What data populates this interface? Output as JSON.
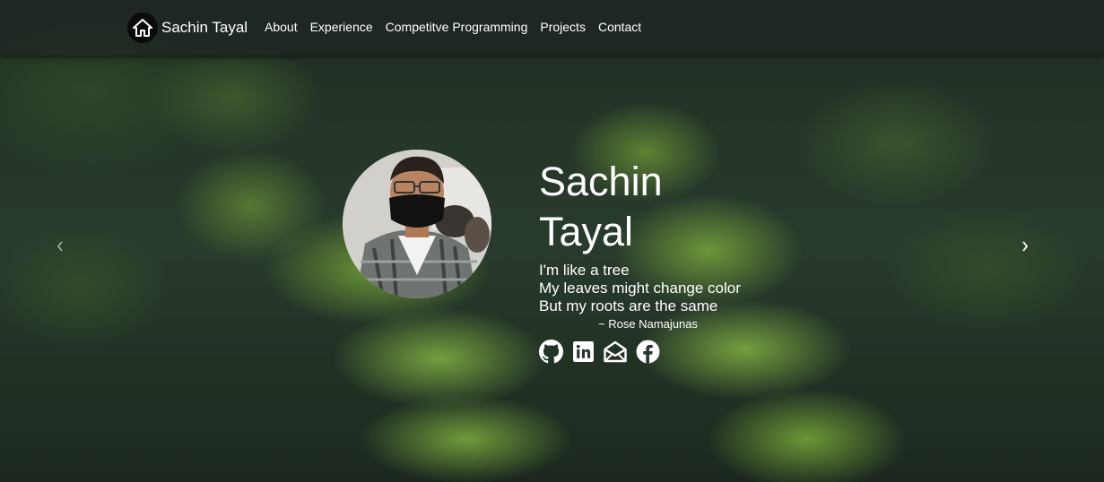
{
  "navbar": {
    "brand_name": "Sachin Tayal",
    "brand_icon": "home-icon",
    "links": [
      {
        "label": "About"
      },
      {
        "label": "Experience"
      },
      {
        "label": "Competitve Programming"
      },
      {
        "label": "Projects"
      },
      {
        "label": "Contact"
      }
    ]
  },
  "hero": {
    "name_line1": "Sachin",
    "name_line2": "Tayal",
    "quote_lines": [
      "I'm like a tree",
      "My leaves might change color",
      "But my roots are the same"
    ],
    "quote_author": "~ Rose Namajunas",
    "socials": [
      {
        "icon": "github-icon"
      },
      {
        "icon": "linkedin-icon"
      },
      {
        "icon": "mail-icon"
      },
      {
        "icon": "facebook-icon"
      }
    ]
  },
  "carousel": {
    "prev_icon": "chevron-left-icon",
    "next_icon": "chevron-right-icon"
  },
  "colors": {
    "text": "#ffffff",
    "navbar_bg": "#1e2622",
    "leaf_green": "#7daa3c"
  }
}
